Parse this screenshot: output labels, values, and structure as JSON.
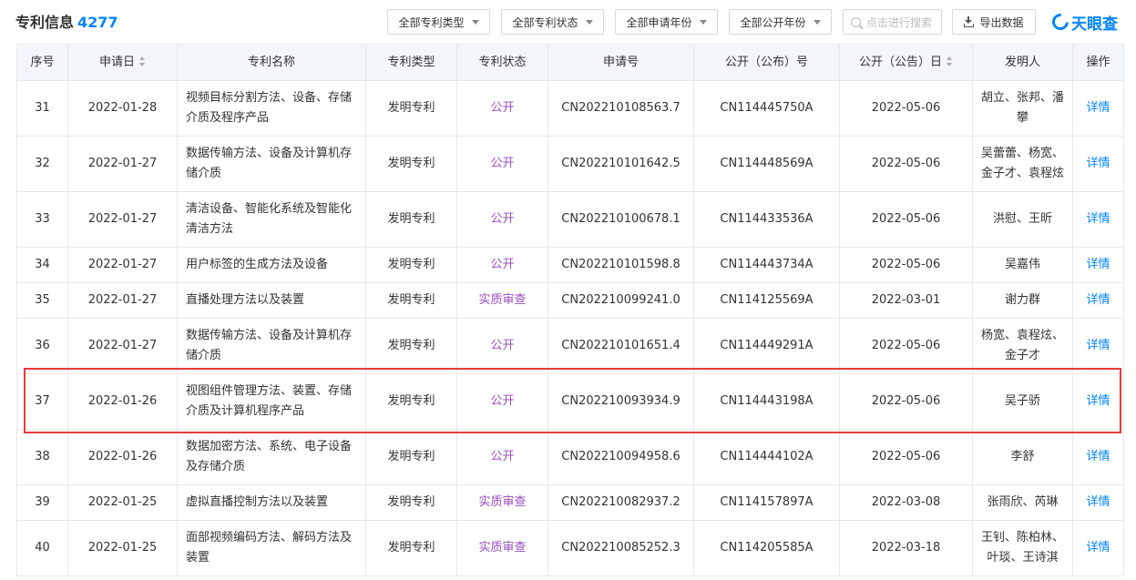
{
  "header": {
    "title": "专利信息",
    "count": "4277",
    "filters": [
      {
        "label": "全部专利类型"
      },
      {
        "label": "全部专利状态"
      },
      {
        "label": "全部申请年份"
      },
      {
        "label": "全部公开年份"
      }
    ],
    "search_placeholder": "点击进行搜索",
    "export_label": "导出数据",
    "logo_text": "天眼查",
    "brand_color": "#0084ff"
  },
  "table": {
    "columns": [
      "序号",
      "申请日",
      "专利名称",
      "专利类型",
      "专利状态",
      "申请号",
      "公开（公布）号",
      "公开（公告）日",
      "发明人",
      "操作"
    ],
    "rows": [
      {
        "no": "31",
        "date": "2022-01-28",
        "name": "视频目标分割方法、设备、存储介质及程序产品",
        "type": "发明专利",
        "status": "公开",
        "app_no": "CN202210108563.7",
        "pub_no": "CN114445750A",
        "pub_date": "2022-05-06",
        "inventor": "胡立、张邦、潘攀",
        "action": "详情"
      },
      {
        "no": "32",
        "date": "2022-01-27",
        "name": "数据传输方法、设备及计算机存储介质",
        "type": "发明专利",
        "status": "公开",
        "app_no": "CN202210101642.5",
        "pub_no": "CN114448569A",
        "pub_date": "2022-05-06",
        "inventor": "吴蕾蕾、杨宽、金子才、袁程炫",
        "action": "详情"
      },
      {
        "no": "33",
        "date": "2022-01-27",
        "name": "清洁设备、智能化系统及智能化清洁方法",
        "type": "发明专利",
        "status": "公开",
        "app_no": "CN202210100678.1",
        "pub_no": "CN114433536A",
        "pub_date": "2022-05-06",
        "inventor": "洪慰、王昕",
        "action": "详情"
      },
      {
        "no": "34",
        "date": "2022-01-27",
        "name": "用户标签的生成方法及设备",
        "type": "发明专利",
        "status": "公开",
        "app_no": "CN202210101598.8",
        "pub_no": "CN114443734A",
        "pub_date": "2022-05-06",
        "inventor": "吴嘉伟",
        "action": "详情"
      },
      {
        "no": "35",
        "date": "2022-01-27",
        "name": "直播处理方法以及装置",
        "type": "发明专利",
        "status": "实质审查",
        "app_no": "CN202210099241.0",
        "pub_no": "CN114125569A",
        "pub_date": "2022-03-01",
        "inventor": "谢力群",
        "action": "详情"
      },
      {
        "no": "36",
        "date": "2022-01-27",
        "name": "数据传输方法、设备及计算机存储介质",
        "type": "发明专利",
        "status": "公开",
        "app_no": "CN202210101651.4",
        "pub_no": "CN114449291A",
        "pub_date": "2022-05-06",
        "inventor": "杨宽、袁程炫、金子才",
        "action": "详情"
      },
      {
        "no": "37",
        "date": "2022-01-26",
        "name": "视图组件管理方法、装置、存储介质及计算机程序产品",
        "type": "发明专利",
        "status": "公开",
        "app_no": "CN202210093934.9",
        "pub_no": "CN114443198A",
        "pub_date": "2022-05-06",
        "inventor": "吴子骄",
        "action": "详情"
      },
      {
        "no": "38",
        "date": "2022-01-26",
        "name": "数据加密方法、系统、电子设备及存储介质",
        "type": "发明专利",
        "status": "公开",
        "app_no": "CN202210094958.6",
        "pub_no": "CN114444102A",
        "pub_date": "2022-05-06",
        "inventor": "李舒",
        "action": "详情"
      },
      {
        "no": "39",
        "date": "2022-01-25",
        "name": "虚拟直播控制方法以及装置",
        "type": "发明专利",
        "status": "实质审查",
        "app_no": "CN202210082937.2",
        "pub_no": "CN114157897A",
        "pub_date": "2022-03-08",
        "inventor": "张雨欣、芮琳",
        "action": "详情"
      },
      {
        "no": "40",
        "date": "2022-01-25",
        "name": "面部视频编码方法、解码方法及装置",
        "type": "发明专利",
        "status": "实质审查",
        "app_no": "CN202210085252.3",
        "pub_no": "CN114205585A",
        "pub_date": "2022-03-18",
        "inventor": "王钊、陈柏林、叶琰、王诗淇",
        "action": "详情"
      }
    ]
  },
  "highlight_color": "#e63b3b"
}
